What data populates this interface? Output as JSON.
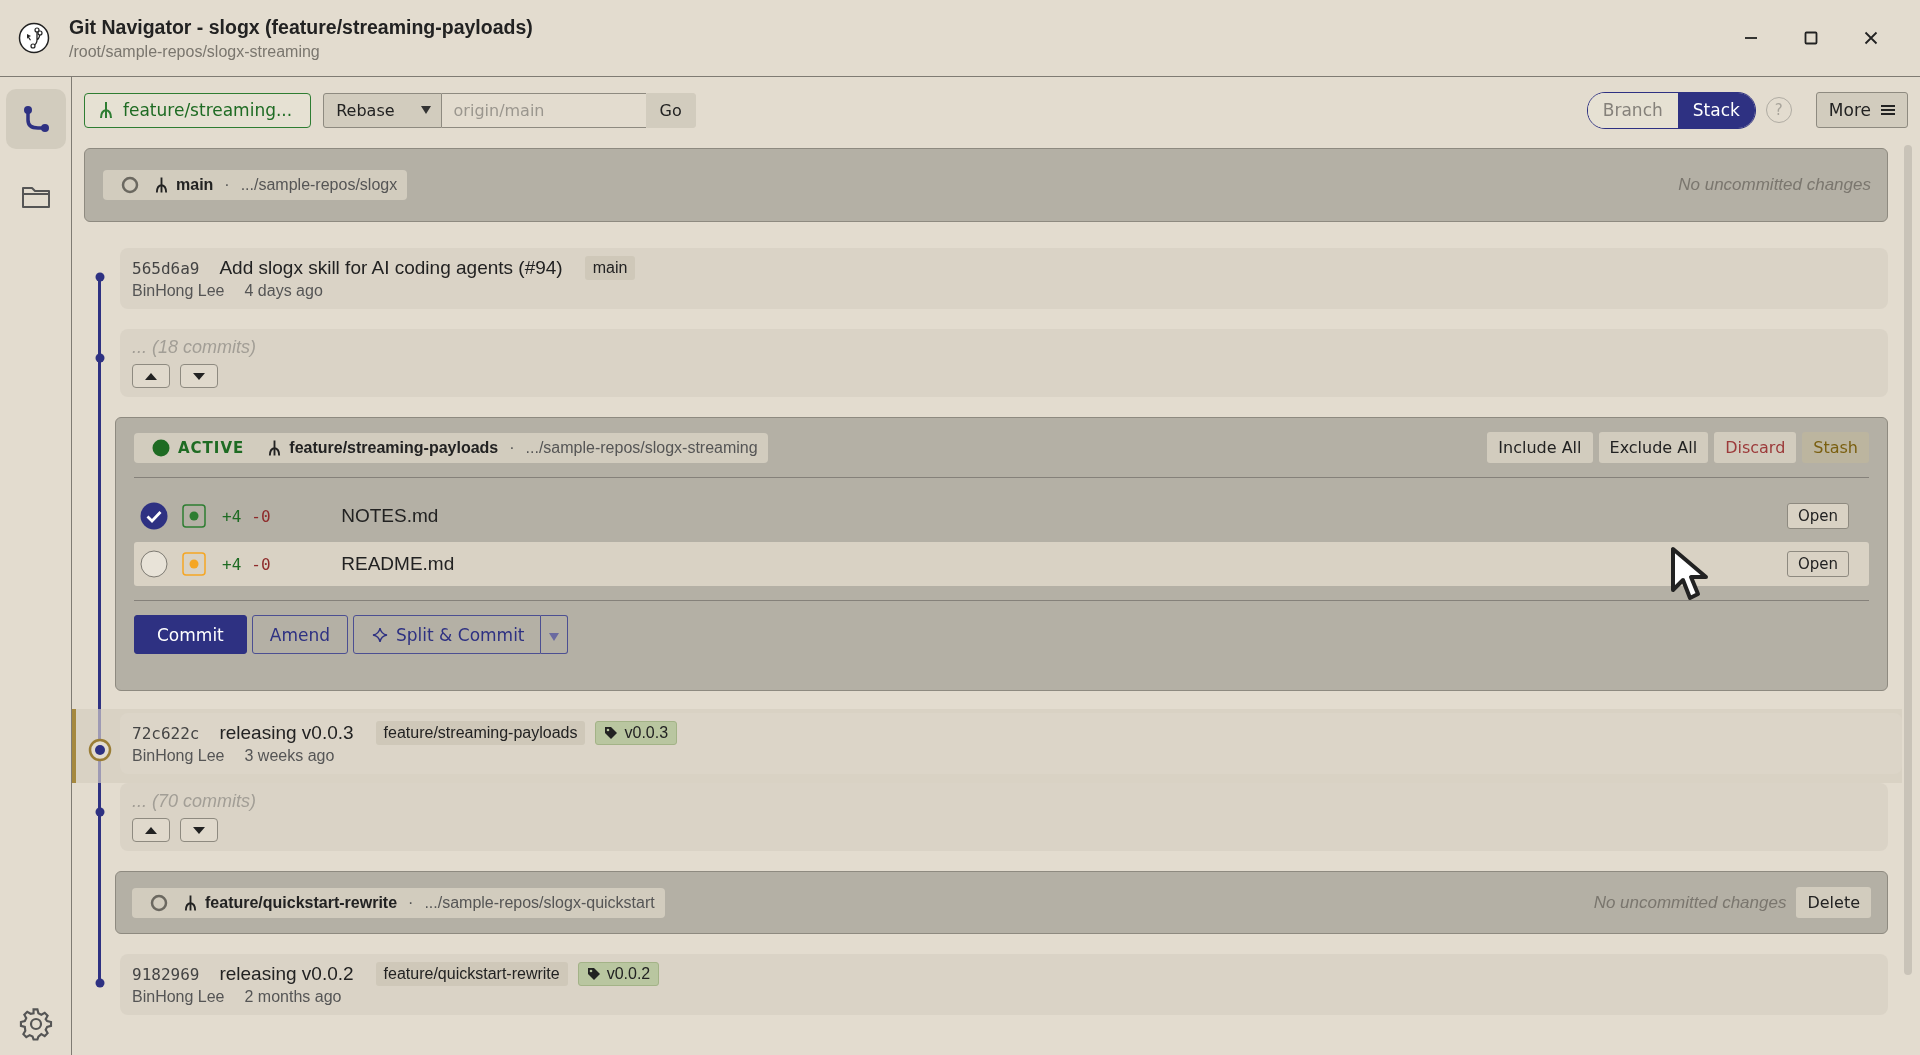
{
  "window": {
    "title": "Git Navigator - slogx (feature/streaming-payloads)",
    "subtitle": "/root/sample-repos/slogx-streaming"
  },
  "sidebar": {
    "items": [
      {
        "kind": "graph",
        "selected": true
      },
      {
        "kind": "folder",
        "selected": false
      }
    ]
  },
  "toolbar": {
    "branch": "feature/streaming...",
    "operation": "Rebase",
    "target": {
      "placeholder": "origin/main"
    },
    "go": "Go",
    "view_modes": [
      {
        "label": "Branch",
        "selected": false
      },
      {
        "label": "Stack",
        "selected": true
      }
    ],
    "help": "?",
    "more": "More"
  },
  "timeline": [
    {
      "kind": "worktree",
      "primary": true,
      "active": false,
      "branch": "main",
      "separator": "·",
      "path": ".../sample-repos/slogx",
      "status": "No uncommitted changes"
    },
    {
      "kind": "commit",
      "current": false,
      "hash": "565d6a9",
      "message": "Add slogx skill for AI coding agents (#94)",
      "author": "BinHong Lee",
      "time": "4 days ago",
      "refs": [
        {
          "kind": "branch",
          "label": "main"
        }
      ]
    },
    {
      "kind": "collapsed",
      "text": "... (18 commits)"
    },
    {
      "kind": "worktree",
      "primary": false,
      "active": true,
      "status_label": "ACTIVE",
      "branch": "feature/streaming-payloads",
      "separator": "·",
      "path": ".../sample-repos/slogx-streaming",
      "actions": [
        {
          "label": "Include All",
          "kind": "normal",
          "disabled": false
        },
        {
          "label": "Exclude All",
          "kind": "normal",
          "disabled": false
        },
        {
          "label": "Discard",
          "kind": "danger",
          "disabled": false
        },
        {
          "label": "Stash",
          "kind": "normal",
          "disabled": true
        }
      ],
      "files": [
        {
          "checked": true,
          "hovered": false,
          "color": "#2e7d32",
          "added": "+4",
          "removed": "-0",
          "name": "NOTES.md",
          "open": "Open"
        },
        {
          "checked": false,
          "hovered": true,
          "color": "#f5a623",
          "added": "+4",
          "removed": "-0",
          "name": "README.md",
          "open": "Open"
        }
      ],
      "commit_actions": [
        {
          "kind": "primary",
          "label": "Commit"
        },
        {
          "kind": "secondary",
          "label": "Amend"
        },
        {
          "kind": "split",
          "label": "Split & Commit"
        }
      ]
    },
    {
      "kind": "commit",
      "current": true,
      "hash": "72c622c",
      "message": "releasing v0.0.3",
      "author": "BinHong Lee",
      "time": "3 weeks ago",
      "refs": [
        {
          "kind": "branch",
          "label": "feature/streaming-payloads"
        },
        {
          "kind": "tag",
          "label": "v0.0.3"
        }
      ]
    },
    {
      "kind": "collapsed",
      "text": "... (70 commits)"
    },
    {
      "kind": "worktree",
      "primary": false,
      "active": false,
      "branch": "feature/quickstart-rewrite",
      "separator": "·",
      "path": ".../sample-repos/slogx-quickstart",
      "status": "No uncommitted changes",
      "actions": [
        {
          "label": "Delete",
          "kind": "normal",
          "disabled": false
        }
      ]
    },
    {
      "kind": "commit",
      "current": false,
      "hash": "9182969",
      "message": "releasing v0.0.2",
      "author": "BinHong Lee",
      "time": "2 months ago",
      "refs": [
        {
          "kind": "branch",
          "label": "feature/quickstart-rewrite"
        },
        {
          "kind": "tag",
          "label": "v0.0.2"
        }
      ]
    }
  ]
}
